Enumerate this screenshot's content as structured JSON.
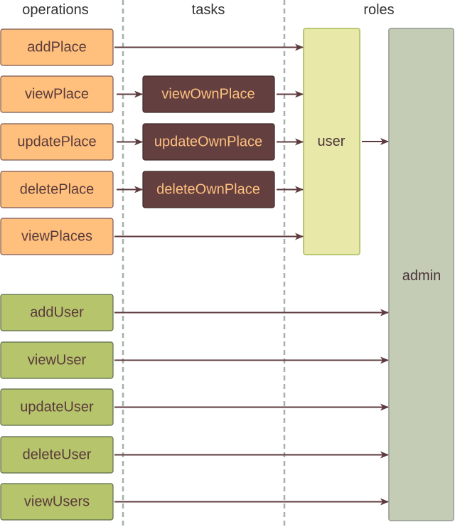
{
  "columns": {
    "operations": "operations",
    "tasks": "tasks",
    "roles": "roles"
  },
  "operations": [
    {
      "label": "addPlace",
      "group": "place",
      "target": "user"
    },
    {
      "label": "viewPlace",
      "group": "place",
      "target": "task:0"
    },
    {
      "label": "updatePlace",
      "group": "place",
      "target": "task:1"
    },
    {
      "label": "deletePlace",
      "group": "place",
      "target": "task:2"
    },
    {
      "label": "viewPlaces",
      "group": "place",
      "target": "user"
    },
    {
      "label": "addUser",
      "group": "user",
      "target": "admin"
    },
    {
      "label": "viewUser",
      "group": "user",
      "target": "admin"
    },
    {
      "label": "updateUser",
      "group": "user",
      "target": "admin"
    },
    {
      "label": "deleteUser",
      "group": "user",
      "target": "admin"
    },
    {
      "label": "viewUsers",
      "group": "user",
      "target": "admin"
    }
  ],
  "tasks": [
    {
      "label": "viewOwnPlace",
      "target": "user"
    },
    {
      "label": "updateOwnPlace",
      "target": "user"
    },
    {
      "label": "deleteOwnPlace",
      "target": "user"
    }
  ],
  "roles": {
    "user": {
      "label": "user",
      "inherits_to": "admin"
    },
    "admin": {
      "label": "admin"
    }
  },
  "colors": {
    "place_op": "#FFC07E",
    "user_op": "#B6C46C",
    "task": "#633F40",
    "user_role": "#E8E8A8",
    "admin_role": "#C4CCB6",
    "arrow": "#5e3b3e"
  }
}
